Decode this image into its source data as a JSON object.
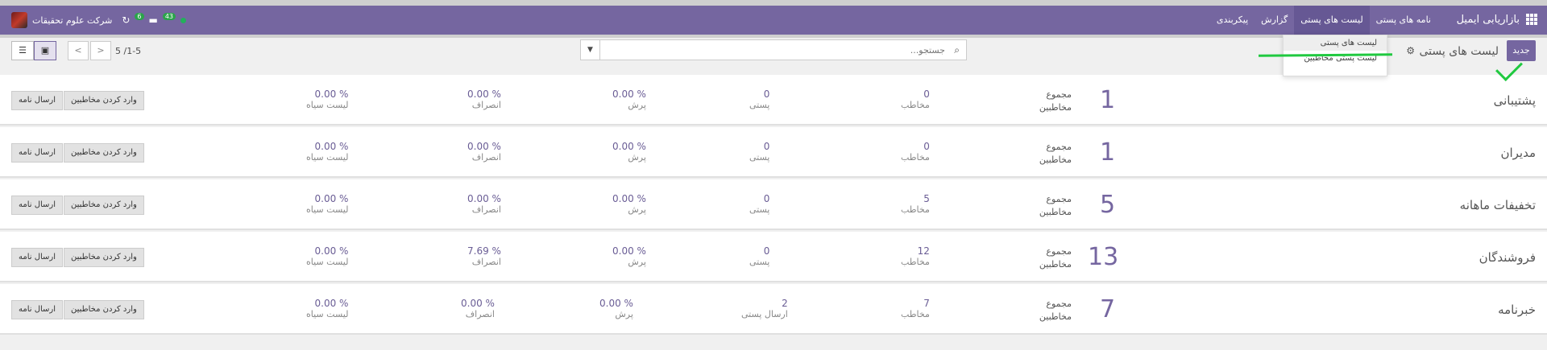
{
  "navbar": {
    "brand": "بازاریابی ایمیل",
    "menu": [
      {
        "label": "نامه های پستی",
        "active": false
      },
      {
        "label": "لیست های پستی",
        "active": true
      },
      {
        "label": "گزارش",
        "active": false
      },
      {
        "label": "پیکربندی",
        "active": false
      }
    ],
    "company": "شرکت علوم تحقیقات",
    "activity_count": "6",
    "messages_count": "43"
  },
  "control": {
    "new_label": "جدید",
    "breadcrumb": "لیست های پستی",
    "search_placeholder": "جستجو...",
    "pager": "5 /1-5",
    "dropdown_items": [
      "لیست های پستی",
      "لیست پستی مخاطبین"
    ]
  },
  "rows": [
    {
      "name": "پشتیبانی",
      "count": "1",
      "sum_label": "مجموع",
      "sum_sub": "مخاطبین",
      "c1v": "0",
      "c1l": "مخاطب",
      "c2v": "0",
      "c2l": "پستی",
      "c3v": "0.00 %",
      "c3l": "پرش",
      "c4v": "0.00 %",
      "c4l": "انصراف",
      "c5v": "0.00 %",
      "c5l": "لیست سیاه"
    },
    {
      "name": "مدیران",
      "count": "1",
      "sum_label": "مجموع",
      "sum_sub": "مخاطبین",
      "c1v": "0",
      "c1l": "مخاطب",
      "c2v": "0",
      "c2l": "پستی",
      "c3v": "0.00 %",
      "c3l": "پرش",
      "c4v": "0.00 %",
      "c4l": "انصراف",
      "c5v": "0.00 %",
      "c5l": "لیست سیاه"
    },
    {
      "name": "تخفیفات ماهانه",
      "count": "5",
      "sum_label": "مجموع",
      "sum_sub": "مخاطبین",
      "c1v": "5",
      "c1l": "مخاطب",
      "c2v": "0",
      "c2l": "پستی",
      "c3v": "0.00 %",
      "c3l": "پرش",
      "c4v": "0.00 %",
      "c4l": "انصراف",
      "c5v": "0.00 %",
      "c5l": "لیست سیاه"
    },
    {
      "name": "فروشندگان",
      "count": "13",
      "sum_label": "مجموع",
      "sum_sub": "مخاطبین",
      "c1v": "12",
      "c1l": "مخاطب",
      "c2v": "0",
      "c2l": "پستی",
      "c3v": "0.00 %",
      "c3l": "پرش",
      "c4v": "7.69 %",
      "c4l": "انصراف",
      "c5v": "0.00 %",
      "c5l": "لیست سیاه"
    },
    {
      "name": "خبرنامه",
      "count": "7",
      "sum_label": "مجموع",
      "sum_sub": "مخاطبین",
      "c1v": "7",
      "c1l": "مخاطب",
      "c2v": "2",
      "c2l": "ارسال پستی",
      "c3v": "0.00 %",
      "c3l": "پرش",
      "c4v": "0.00 %",
      "c4l": "انصراف",
      "c5v": "0.00 %",
      "c5l": "لیست سیاه"
    }
  ],
  "row_buttons": {
    "import": "وارد کردن مخاطبین",
    "send": "ارسال نامه"
  },
  "colors": {
    "brand": "#7566a0",
    "highlight": "#20c940",
    "online": "#23b05b"
  }
}
